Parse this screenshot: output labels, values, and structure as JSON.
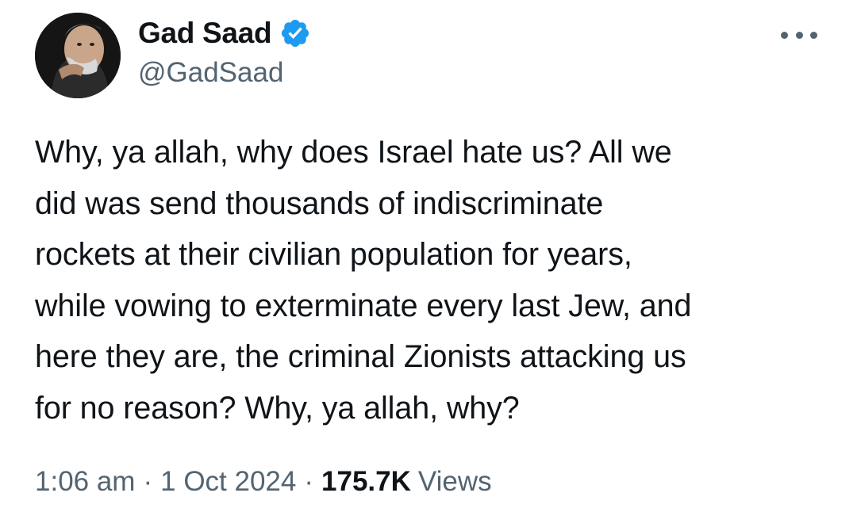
{
  "author": {
    "display_name": "Gad Saad",
    "handle": "@GadSaad",
    "verified": true,
    "verified_color": "#1d9bf0"
  },
  "tweet": {
    "text": "Why, ya allah, why does Israel hate us?  All we\ndid was send thousands of indiscriminate\nrockets at their civilian population for years,\nwhile vowing to exterminate every last Jew, and\nhere they are, the criminal Zionists attacking us\nfor no reason?  Why, ya allah, why?",
    "time": "1:06 am",
    "date": "1 Oct 2024",
    "separator": "·",
    "views_count": "175.7K",
    "views_label": "Views"
  },
  "icons": {
    "verified": "verified-badge-icon",
    "more": "more-options-icon"
  },
  "colors": {
    "text_primary": "#0f1419",
    "text_secondary": "#536471",
    "background": "#ffffff"
  }
}
